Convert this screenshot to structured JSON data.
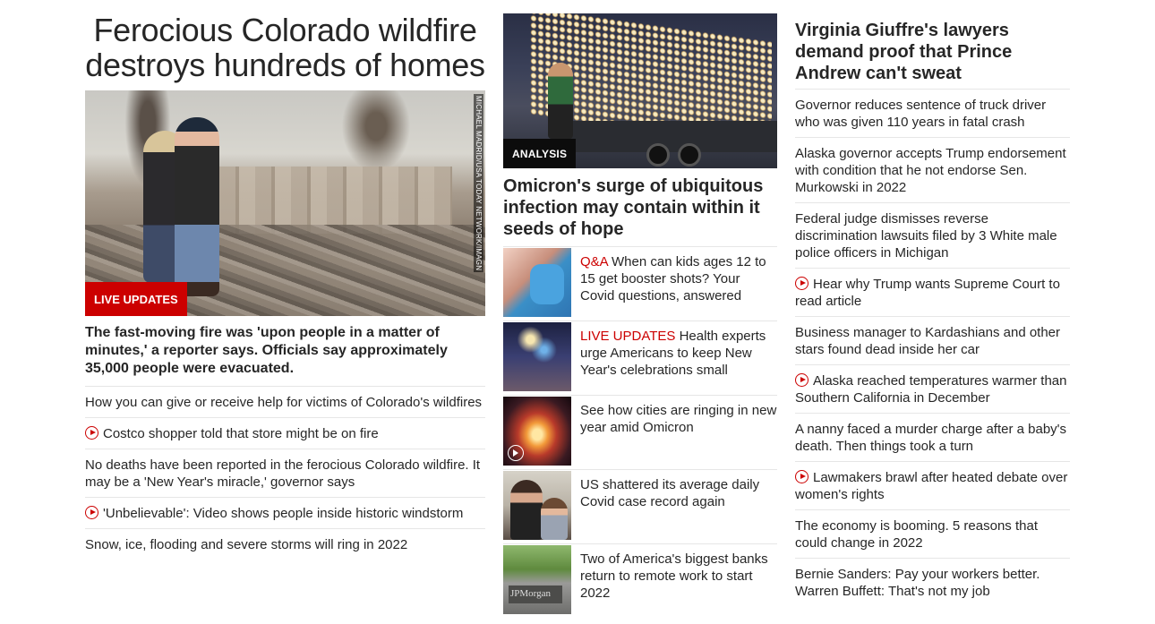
{
  "col1": {
    "headline": "Ferocious Colorado wildfire destroys hundreds of homes",
    "image_credit": "MICHAEL MADRID/USA TODAY NETWORK/IMAGN",
    "badge": "LIVE UPDATES",
    "subhead": "The fast-moving fire was 'upon people in a matter of minutes,' a reporter says. Officials say approximately 35,000 people were evacuated.",
    "items": [
      {
        "text": "How you can give or receive help for victims of Colorado's wildfires",
        "video": false
      },
      {
        "text": "Costco shopper told that store might be on fire",
        "video": true
      },
      {
        "text": "No deaths have been reported in the ferocious Colorado wildfire. It may be a 'New Year's miracle,' governor says",
        "video": false
      },
      {
        "text": "'Unbelievable': Video shows people inside historic windstorm",
        "video": true
      },
      {
        "text": "Snow, ice, flooding and severe storms will ring in 2022",
        "video": false
      }
    ]
  },
  "col2": {
    "badge": "ANALYSIS",
    "headline": "Omicron's surge of ubiquitous infection may contain within it seeds of hope",
    "rows": [
      {
        "kicker": "Q&A",
        "text": " When can kids ages 12 to 15 get booster shots? Your Covid questions, answered"
      },
      {
        "kicker": "LIVE UPDATES",
        "text": " Health experts urge Americans to keep New Year's celebrations small"
      },
      {
        "kicker": "",
        "text": "See how cities are ringing in new year amid Omicron"
      },
      {
        "kicker": "",
        "text": "US shattered its average daily Covid case record again"
      },
      {
        "kicker": "",
        "text": "Two of America's biggest banks return to remote work to start 2022"
      }
    ],
    "thumb5_sign": "JPMorgan"
  },
  "col3": {
    "headline": "Virginia Giuffre's lawyers demand proof that Prince Andrew can't sweat",
    "items": [
      {
        "text": "Governor reduces sentence of truck driver who was given 110 years in fatal crash",
        "video": false
      },
      {
        "text": "Alaska governor accepts Trump endorsement with condition that he not endorse Sen. Murkowski in 2022",
        "video": false
      },
      {
        "text": "Federal judge dismisses reverse discrimination lawsuits filed by 3 White male police officers in Michigan",
        "video": false
      },
      {
        "text": "Hear why Trump wants Supreme Court to read article",
        "video": true
      },
      {
        "text": "Business manager to Kardashians and other stars found dead inside her car",
        "video": false
      },
      {
        "text": "Alaska reached temperatures warmer than Southern California in December",
        "video": true
      },
      {
        "text": "A nanny faced a murder charge after a baby's death. Then things took a turn",
        "video": false
      },
      {
        "text": "Lawmakers brawl after heated debate over women's rights",
        "video": true
      },
      {
        "text": "The economy is booming. 5 reasons that could change in 2022",
        "video": false
      },
      {
        "text": "Bernie Sanders: Pay your workers better. Warren Buffett: That's not my job",
        "video": false
      }
    ]
  },
  "colors": {
    "accent_red": "#cc0000",
    "text": "#262626",
    "divider": "#e6e6e6"
  }
}
